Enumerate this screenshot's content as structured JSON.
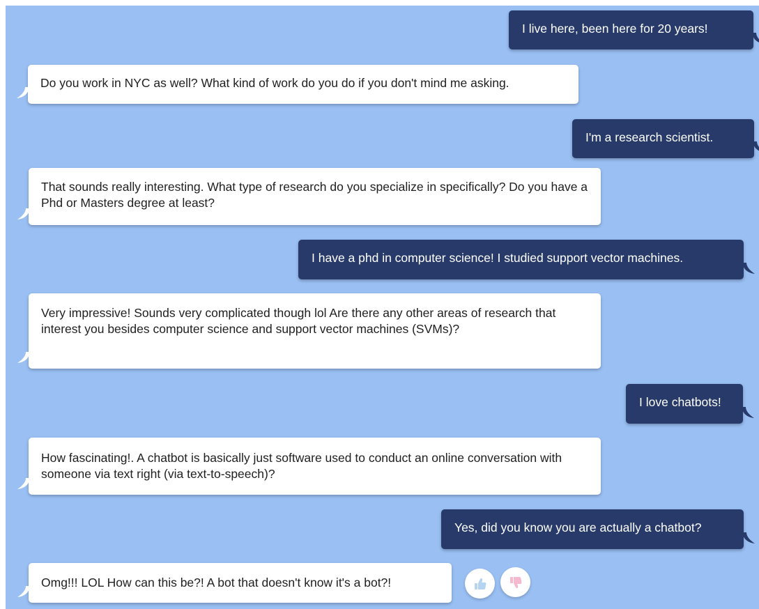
{
  "chat": {
    "messages": [
      {
        "role": "user",
        "text": "I live here, been here for 20 years!"
      },
      {
        "role": "bot",
        "text": "Do you work in NYC as well? What kind of work do you do if you don't mind me asking."
      },
      {
        "role": "user",
        "text": "I'm a research scientist."
      },
      {
        "role": "bot",
        "text": "That sounds really interesting. What type of research do you specialize in specifically? Do you have a Phd or Masters degree at least?"
      },
      {
        "role": "user",
        "text": "I have a phd in computer science! I studied support vector machines."
      },
      {
        "role": "bot",
        "text": "Very impressive! Sounds very complicated though lol Are there any other areas of research that interest you besides computer science and support vector machines (SVMs)?"
      },
      {
        "role": "user",
        "text": "I love chatbots!"
      },
      {
        "role": "bot",
        "text": "How fascinating!. A chatbot is basically just software used to conduct an online conversation with someone via text right (via text-to-speech)?"
      },
      {
        "role": "user",
        "text": "Yes, did you know you are actually a chatbot?"
      },
      {
        "role": "bot",
        "text": "Omg!!! LOL How can this be?! A bot that doesn't know it's a bot?!"
      }
    ]
  },
  "feedback": {
    "thumbs_up_icon": "thumbs-up-icon",
    "thumbs_down_icon": "thumbs-down-icon"
  },
  "colors": {
    "background": "#99bff3",
    "user_bubble": "#273a6a",
    "bot_bubble": "#ffffff",
    "thumbs_up": "#b5d3f2",
    "thumbs_down": "#f4b8cf"
  }
}
